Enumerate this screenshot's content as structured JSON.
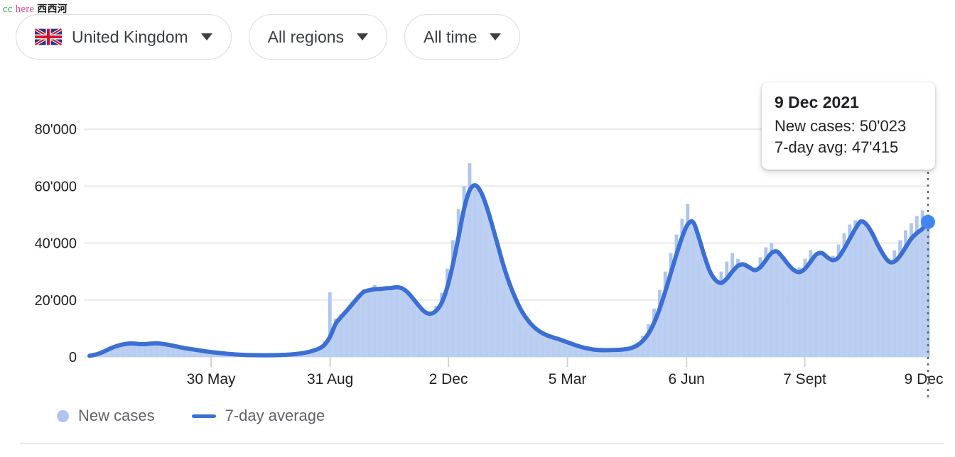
{
  "watermark": {
    "cc": "cc",
    "here": "here",
    "cn": "西西河"
  },
  "filters": [
    {
      "name": "country",
      "label": "United Kingdom",
      "icon": "uk-flag-icon",
      "caret": "chevron-down-icon"
    },
    {
      "name": "regions",
      "label": "All regions",
      "caret": "chevron-down-icon"
    },
    {
      "name": "time-range",
      "label": "All time",
      "caret": "chevron-down-icon"
    }
  ],
  "tooltip": {
    "date": "9 Dec 2021",
    "new_cases": "New cases: 50'023",
    "seven_day_avg": "7-day avg: 47'415"
  },
  "legend": [
    {
      "label": "New cases",
      "marker": "dot",
      "color": "#aec5f0"
    },
    {
      "label": "7-day average",
      "marker": "line",
      "color": "#3b6fd4"
    }
  ],
  "colors": {
    "line": "#3b6fd4",
    "bars": "#aec5f0",
    "area": "#b9cef1",
    "gridline": "#e8eaed",
    "axis_text": "#202124",
    "legend_text": "#5f6368",
    "pill_border": "#dadce0",
    "marker": "#4285f4",
    "cursor_line": "#5f6368"
  },
  "chart_data": {
    "type": "area",
    "title": "",
    "xlabel": "",
    "ylabel": "",
    "ylim": [
      0,
      88000
    ],
    "grid": true,
    "legend_position": "bottom-left",
    "y_ticks": [
      0,
      20000,
      40000,
      60000,
      80000
    ],
    "y_tick_labels": [
      "0",
      "20'000",
      "40'000",
      "60'000",
      "80'000"
    ],
    "x_tick_labels": [
      "30 May",
      "31 Aug",
      "2 Dec",
      "5 Mar",
      "6 Jun",
      "7 Sept",
      "9 Dec"
    ],
    "x_tick_fractions": [
      0.145,
      0.287,
      0.428,
      0.57,
      0.712,
      0.853,
      0.995
    ],
    "annotation": {
      "date": "9 Dec 2021",
      "new_cases": 50023,
      "seven_day_avg": 47415,
      "cursor_line": true,
      "marker_dot": true
    },
    "series": [
      {
        "name": "New cases",
        "type": "bar",
        "color": "#aec5f0",
        "values": [
          300,
          900,
          1500,
          2600,
          3600,
          4300,
          4900,
          5200,
          4700,
          4300,
          4600,
          4900,
          4700,
          4300,
          4000,
          3600,
          3200,
          2900,
          2600,
          2300,
          2000,
          1700,
          1500,
          1300,
          1100,
          900,
          800,
          700,
          650,
          620,
          600,
          580,
          600,
          640,
          700,
          780,
          900,
          1100,
          1400,
          1800,
          2400,
          3200,
          5500,
          22700,
          13500,
          15000,
          16500,
          19500,
          21800,
          23800,
          22500,
          25300,
          24100,
          23800,
          24500,
          24900,
          22700,
          20900,
          18200,
          16100,
          14800,
          15500,
          17900,
          22500,
          31000,
          41000,
          52000,
          60000,
          68053,
          59000,
          52000,
          44000,
          36000,
          30000,
          24000,
          19000,
          15000,
          12000,
          9500,
          8000,
          7200,
          6600,
          6100,
          5500,
          4800,
          4100,
          3400,
          2900,
          2600,
          2400,
          2300,
          2350,
          2400,
          2450,
          2500,
          2600,
          2900,
          3600,
          5000,
          7500,
          11500,
          17000,
          23500,
          30000,
          36500,
          43000,
          48500,
          53800,
          44000,
          34000,
          27500,
          25000,
          26500,
          30000,
          33500,
          36500,
          34500,
          30000,
          28500,
          31000,
          35000,
          38500,
          40000,
          36000,
          32000,
          30500,
          29800,
          31500,
          34500,
          37500,
          36500,
          34000,
          33500,
          35500,
          39500,
          43500,
          46500,
          48000,
          45000,
          41000,
          37500,
          34500,
          33000,
          34500,
          37500,
          41000,
          44500,
          47000,
          49500,
          51500,
          50023
        ]
      },
      {
        "name": "7-day average",
        "type": "line",
        "color": "#3b6fd4",
        "values": [
          400,
          800,
          1400,
          2300,
          3200,
          3900,
          4400,
          4700,
          4700,
          4500,
          4500,
          4700,
          4800,
          4600,
          4300,
          3900,
          3500,
          3100,
          2800,
          2500,
          2200,
          1900,
          1650,
          1450,
          1250,
          1050,
          900,
          780,
          700,
          650,
          610,
          590,
          600,
          630,
          680,
          760,
          880,
          1050,
          1300,
          1650,
          2200,
          2900,
          4200,
          7000,
          11500,
          14000,
          16200,
          18500,
          20800,
          22800,
          23400,
          23800,
          23900,
          24100,
          24200,
          24500,
          24000,
          22500,
          20200,
          17800,
          15800,
          15200,
          16200,
          19000,
          24500,
          32500,
          42000,
          52000,
          58500,
          60300,
          58000,
          53000,
          46500,
          39500,
          32500,
          26500,
          21500,
          17200,
          14000,
          11500,
          9700,
          8400,
          7500,
          6800,
          6200,
          5500,
          4800,
          4100,
          3500,
          3000,
          2650,
          2450,
          2380,
          2400,
          2450,
          2550,
          2750,
          3200,
          4100,
          5700,
          8200,
          12000,
          17000,
          23000,
          29500,
          36000,
          42000,
          46500,
          47300,
          42000,
          35500,
          30000,
          27000,
          26000,
          27500,
          30000,
          32000,
          32500,
          31500,
          30500,
          31500,
          34000,
          36500,
          37000,
          35000,
          32500,
          30500,
          29800,
          31000,
          33500,
          36000,
          36500,
          35000,
          34000,
          35000,
          38000,
          41500,
          45000,
          47600,
          46500,
          43500,
          39500,
          36000,
          33500,
          33500,
          35500,
          38500,
          41500,
          43500,
          45000,
          47415
        ]
      }
    ]
  }
}
